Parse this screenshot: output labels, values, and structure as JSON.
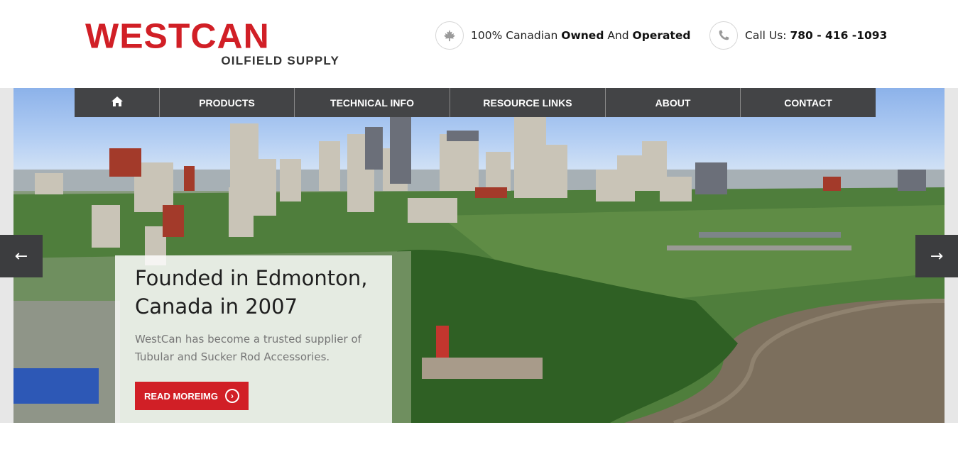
{
  "logo": {
    "main": "WESTCAN",
    "sub": "OILFIELD SUPPLY"
  },
  "info1": {
    "icon": "maple-leaf-icon",
    "prefix": "100% Canadian ",
    "b1": "Owned",
    "mid": " And ",
    "b2": "Operated"
  },
  "info2": {
    "icon": "phone-icon",
    "prefix": "Call Us: ",
    "phone": "780 - 416 -1093"
  },
  "nav": {
    "home_icon": "home-icon",
    "items": [
      "PRODUCTS",
      "TECHNICAL INFO",
      "RESOURCE LINKS",
      "ABOUT",
      "CONTACT"
    ]
  },
  "slider": {
    "prev": "←",
    "next": "→",
    "title": "Founded in Edmonton, Canada in 2007",
    "text": "WestCan has become a trusted supplier of Tubular and Sucker Rod Accessories.",
    "button": "READ MOREIMG"
  },
  "colors": {
    "brand": "#d11f26",
    "nav": "#434446"
  }
}
